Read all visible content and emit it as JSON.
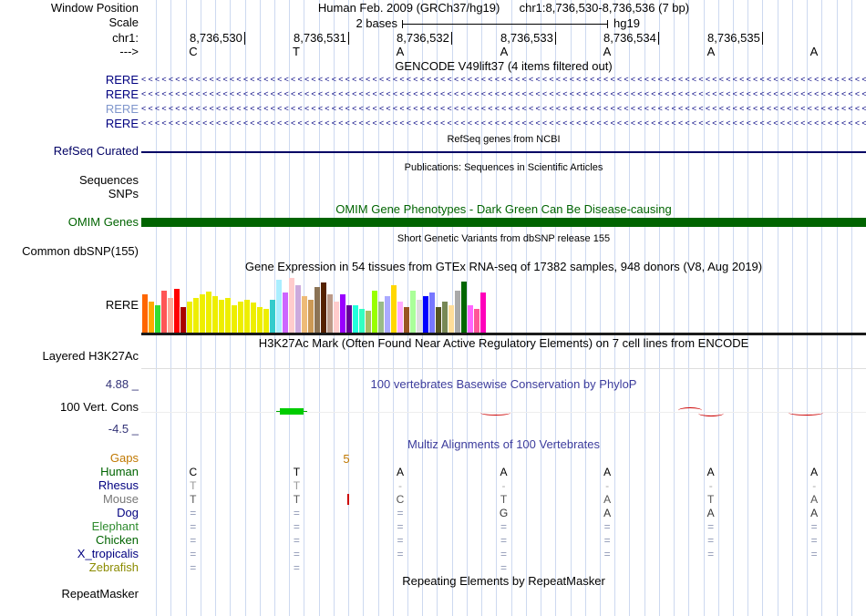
{
  "header": {
    "window_position_label": "Window Position",
    "assembly": "Human Feb. 2009 (GRCh37/hg19)",
    "position": "chr1:8,736,530-8,736,536 (7 bp)",
    "scale_label": "Scale",
    "scale_value": "2 bases",
    "genome": "hg19",
    "chrom_label": "chr1:",
    "strand_label": "--->",
    "coords": [
      "8,736,530",
      "8,736,531",
      "8,736,532",
      "8,736,533",
      "8,736,534",
      "8,736,535"
    ],
    "bases": [
      "C",
      "T",
      "A",
      "A",
      "A",
      "A",
      "A"
    ]
  },
  "tracks": {
    "gencode": {
      "title": "GENCODE V49lift37 (4 items filtered out)",
      "arrow_char": "<",
      "arrow_repeat": 110,
      "transcripts": [
        {
          "label": "RERE",
          "label_color": "#000080"
        },
        {
          "label": "RERE",
          "label_color": "#000080"
        },
        {
          "label": "RERE",
          "label_color": "#7f96cc"
        },
        {
          "label": "RERE",
          "label_color": "#000080"
        }
      ]
    },
    "refseq": {
      "title": "RefSeq genes from NCBI",
      "label": "RefSeq Curated",
      "color": "#000064"
    },
    "publications": {
      "title": "Publications: Sequences in Scientific Articles",
      "sequences_label": "Sequences",
      "snps_label": "SNPs"
    },
    "omim": {
      "title": "OMIM Gene Phenotypes - Dark Green Can Be Disease-causing",
      "label": "OMIM Genes",
      "color": "#006400"
    },
    "dbsnp": {
      "title": "Short Genetic Variants from dbSNP release 155",
      "label": "Common dbSNP(155)"
    },
    "gtex": {
      "title": "Gene Expression in 54 tissues from GTEx RNA-seq of 17382 samples, 948 donors (V8, Aug 2019)",
      "label": "RERE"
    },
    "h3k27ac": {
      "title": "H3K27Ac Mark (Often Found Near Active Regulatory Elements) on 7 cell lines from ENCODE",
      "label": "Layered H3K27Ac"
    },
    "phylop": {
      "title": "100 vertebrates Basewise Conservation by PhyloP",
      "label": "100 Vert. Cons",
      "max_score": "4.88 _",
      "min_score": "-4.5 _"
    },
    "multiz": {
      "title": "Multiz Alignments of 100 Vertebrates",
      "gaps_label": "Gaps",
      "gap_size": "5",
      "species": [
        {
          "name": "Human",
          "name_color": "#006400",
          "base_color": "#000000",
          "cells": [
            "C",
            "T",
            "A",
            "A",
            "A",
            "A",
            "A"
          ]
        },
        {
          "name": "Rhesus",
          "name_color": "#000080",
          "base_color": "#999999",
          "cells": [
            "T",
            "T",
            "-",
            "-",
            "-",
            "-",
            "-"
          ]
        },
        {
          "name": "Mouse",
          "name_color": "#777777",
          "base_color": "#555555",
          "cells": [
            "T",
            "T",
            "C",
            "T",
            "A",
            "T",
            "A"
          ]
        },
        {
          "name": "Dog",
          "name_color": "#000080",
          "base_color": "#333333",
          "cells": [
            "=",
            "=",
            "=",
            "G",
            "A",
            "A",
            "A"
          ]
        },
        {
          "name": "Elephant",
          "name_color": "#2e8b2e",
          "base_color": "#333333",
          "cells": [
            "=",
            "=",
            "=",
            "=",
            "=",
            "=",
            "="
          ]
        },
        {
          "name": "Chicken",
          "name_color": "#006400",
          "base_color": "#333333",
          "cells": [
            "=",
            "=",
            "=",
            "=",
            "=",
            "=",
            "="
          ]
        },
        {
          "name": "X_tropicalis",
          "name_color": "#000080",
          "base_color": "#333333",
          "cells": [
            "=",
            "=",
            "=",
            "=",
            "=",
            "=",
            "="
          ]
        },
        {
          "name": "Zebrafish",
          "name_color": "#8b8b00",
          "base_color": "#333333",
          "cells": [
            "=",
            "=",
            "",
            "=",
            "",
            "",
            ""
          ]
        }
      ]
    },
    "repeatmasker": {
      "title": "Repeating Elements by RepeatMasker",
      "label": "RepeatMasker"
    }
  },
  "colors": {
    "guideline": "#cdd9f0",
    "gencode_blue": "#000080",
    "omim_green": "#006400",
    "conservation_title_blue": "#3c3c9c",
    "gaps_orange": "#c07800",
    "phylop_pos_green": "#00cc00",
    "phylop_neg_red": "#cc0000"
  },
  "chart_data": {
    "type": "bar",
    "title": "Gene Expression in 54 tissues from GTEx RNA-seq of 17382 samples, 948 donors (V8, Aug 2019)",
    "gene": "RERE",
    "unit": "bar pixel height (relative expression)",
    "values": [
      42,
      34,
      30,
      46,
      38,
      48,
      28,
      34,
      38,
      42,
      45,
      40,
      36,
      38,
      30,
      34,
      36,
      33,
      28,
      26,
      36,
      58,
      44,
      60,
      52,
      40,
      36,
      50,
      55,
      42,
      34,
      42,
      30,
      30,
      26,
      24,
      46,
      34,
      40,
      52,
      34,
      28,
      46,
      36,
      40,
      44,
      28,
      34,
      30,
      46,
      56,
      30,
      26,
      44
    ],
    "colors": [
      "#FF6600",
      "#FFAA00",
      "#33DD33",
      "#FF5555",
      "#FFAA99",
      "#FF0000",
      "#AA0000",
      "#EEEE00",
      "#EEEE00",
      "#EEEE00",
      "#EEEE00",
      "#EEEE00",
      "#EEEE00",
      "#EEEE00",
      "#EEEE00",
      "#EEEE00",
      "#EEEE00",
      "#EEEE00",
      "#EEEE00",
      "#EEEE00",
      "#33CCCC",
      "#AAEEFF",
      "#CC66FF",
      "#FFCCCC",
      "#CCAADD",
      "#EEBB77",
      "#CC9955",
      "#8B7355",
      "#552200",
      "#BB9988",
      "#FFCCCC",
      "#9900FF",
      "#660099",
      "#22FFDD",
      "#33FFC2",
      "#AABB66",
      "#99FF00",
      "#99BB88",
      "#AAAAFF",
      "#FFD700",
      "#FFAAFF",
      "#995522",
      "#AAFF99",
      "#DDDDDD",
      "#0000FF",
      "#7777FF",
      "#555522",
      "#778855",
      "#FFDD99",
      "#AAAAAA",
      "#006600",
      "#FF66FF",
      "#FF5599",
      "#FF00BB"
    ]
  }
}
